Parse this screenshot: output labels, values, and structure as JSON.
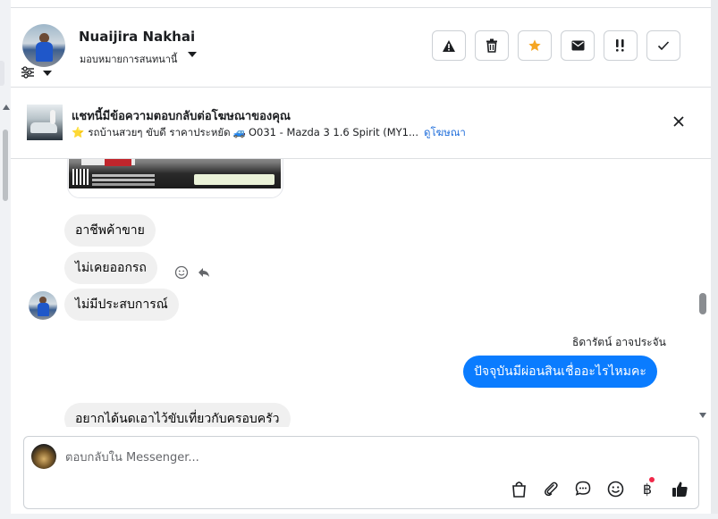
{
  "contact": {
    "name": "Nuaijira Nakhai",
    "assign_label": "มอบหมายการสนทนานี้"
  },
  "header_actions": [
    {
      "name": "spam-button",
      "icon": "warning-icon"
    },
    {
      "name": "delete-button",
      "icon": "trash-icon"
    },
    {
      "name": "star-button",
      "icon": "star-icon"
    },
    {
      "name": "mark-unread-button",
      "icon": "envelope-icon"
    },
    {
      "name": "follow-up-button",
      "icon": "exclamation-icon"
    },
    {
      "name": "mark-done-button",
      "icon": "checkmark-icon"
    }
  ],
  "ad_banner": {
    "title": "แชทนี้มีข้อความตอบกลับต่อโฆษณาของคุณ",
    "star": "⭐",
    "subtitle_a": "รถบ้านสวยๆ ขับดี ราคาประหยัด",
    "car": "🚙",
    "subtitle_b": "O031 - Mazda 3 1.6 Spirit (MY1...",
    "link_label": "ดูโฆษณา"
  },
  "messages": {
    "in_1": "อาชีพค้าขาย",
    "in_2": "ไม่เคยออกรถ",
    "in_3": "ไม่มีประสบการณ์",
    "sender_name": "ธิดารัตน์ อาจประจัน",
    "out_1": "ปัจจุบันมีผ่อนสินเชื่ออะไรไหมคะ",
    "in_4": "อยากได้นดเอาไว้ขับเที่ยวกับครอบครัว"
  },
  "composer": {
    "placeholder": "ตอบกลับใน Messenger...",
    "value": "",
    "tools": [
      "shopping-bag-icon",
      "paperclip-icon",
      "chat-bubble-icon",
      "emoji-icon",
      "baht-icon",
      "thumbs-up-icon"
    ],
    "baht_symbol": "฿"
  },
  "colors": {
    "accent_blue": "#0a7cff",
    "link_blue": "#216fdb",
    "star_orange": "#f5a623",
    "notification_red": "#f02849",
    "incoming_bubble": "#f0f0f0"
  }
}
